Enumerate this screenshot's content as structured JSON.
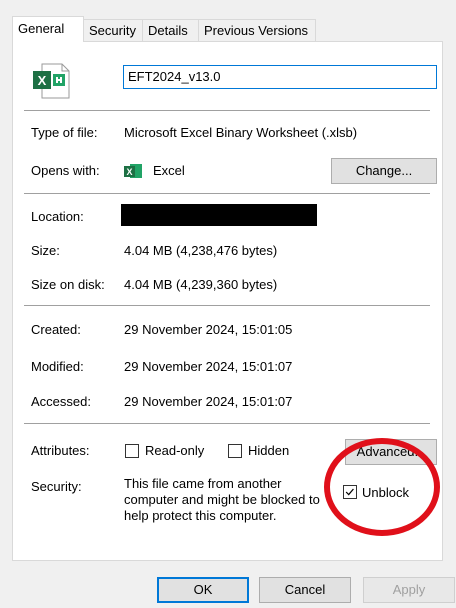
{
  "tabs": [
    {
      "label": "General",
      "active": true
    },
    {
      "label": "Security",
      "active": false
    },
    {
      "label": "Details",
      "active": false
    },
    {
      "label": "Previous Versions",
      "active": false
    }
  ],
  "file": {
    "name": "EFT2024_v13.0",
    "icon": "excel-icon"
  },
  "type_of_file": {
    "label": "Type of file:",
    "value": "Microsoft Excel Binary Worksheet (.xlsb)"
  },
  "opens_with": {
    "label": "Opens with:",
    "value": "Excel",
    "button": "Change..."
  },
  "location": {
    "label": "Location:",
    "value_redacted": true
  },
  "size": {
    "label": "Size:",
    "value": "4.04 MB (4,238,476 bytes)"
  },
  "size_on_disk": {
    "label": "Size on disk:",
    "value": "4.04 MB (4,239,360 bytes)"
  },
  "created": {
    "label": "Created:",
    "value": "29 November 2024, 15:01:05"
  },
  "modified": {
    "label": "Modified:",
    "value": "29 November 2024, 15:01:07"
  },
  "accessed": {
    "label": "Accessed:",
    "value": "29 November 2024, 15:01:07"
  },
  "attributes": {
    "label": "Attributes:",
    "readonly": {
      "label": "Read-only",
      "checked": false
    },
    "hidden": {
      "label": "Hidden",
      "checked": false
    },
    "advanced_button": "Advanced..."
  },
  "security": {
    "label": "Security:",
    "text_lines": [
      "This file came from another",
      "computer and might be blocked to",
      "help protect this computer."
    ],
    "unblock": {
      "label": "Unblock",
      "checked": true
    }
  },
  "footer": {
    "ok": "OK",
    "cancel": "Cancel",
    "apply": "Apply"
  },
  "colors": {
    "accent": "#0078d7",
    "excel_green": "#1d7044",
    "annotation_red": "#e0101a"
  }
}
